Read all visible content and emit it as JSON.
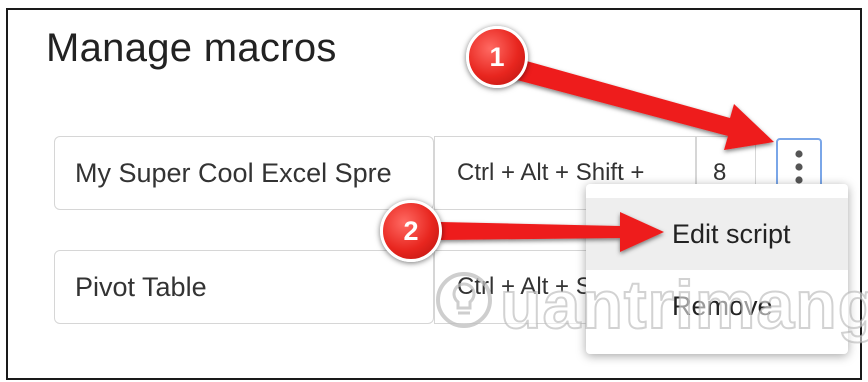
{
  "dialog": {
    "title": "Manage macros"
  },
  "macros": [
    {
      "name": "My Super Cool Excel Spre",
      "shortcut_prefix": "Ctrl + Alt + Shift +",
      "shortcut_key": "8"
    },
    {
      "name": "Pivot Table",
      "shortcut_prefix": "Ctrl + Alt + Shift +",
      "shortcut_key": ""
    }
  ],
  "menu": {
    "items": [
      {
        "label": "Edit script",
        "hovered": true
      },
      {
        "label": "Remove",
        "hovered": false
      }
    ]
  },
  "annotations": [
    {
      "number": "1"
    },
    {
      "number": "2"
    }
  ],
  "watermark": {
    "text": "uantrimang"
  },
  "colors": {
    "badge": "#e8261f",
    "arrow": "#ee1c1c",
    "focus_border": "#7aa6e8",
    "menu_hover": "#eeeeee"
  },
  "icons": {
    "more": "more-vert-icon",
    "watermark_logo": "quantrimang-logo"
  }
}
